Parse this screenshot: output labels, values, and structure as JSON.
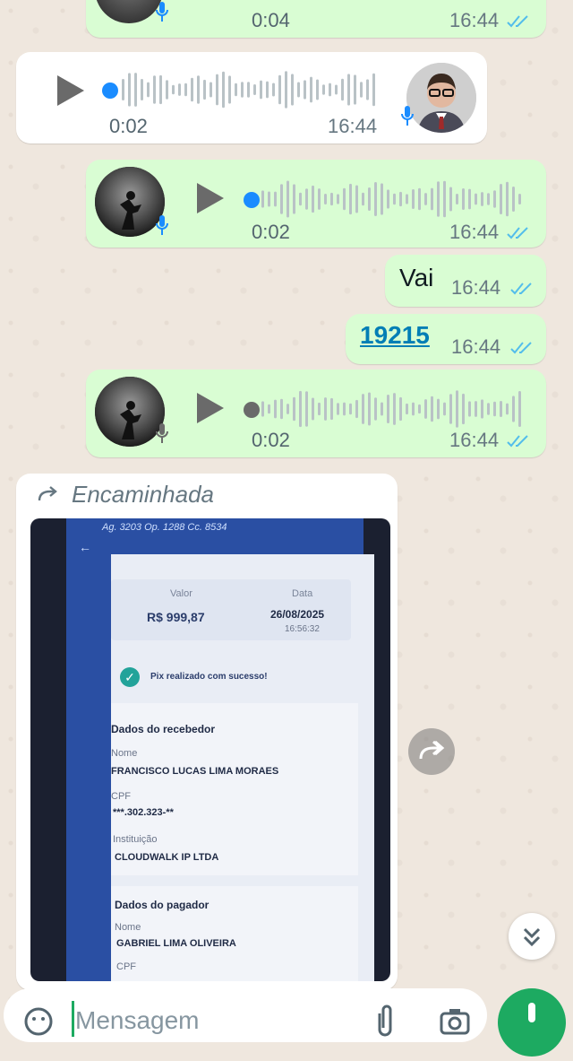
{
  "colors": {
    "outgoing_bubble": "#d9fdd3",
    "incoming_bubble": "#ffffff",
    "read_ticks": "#53bdeb",
    "unplayed_knob": "#1a8cff",
    "played_knob": "#6a6a6a",
    "link": "#027eb5",
    "send_button": "#1daa61"
  },
  "messages": [
    {
      "type": "voice",
      "direction": "outgoing",
      "duration": "0:04",
      "time": "16:44",
      "status": "read"
    },
    {
      "type": "voice",
      "direction": "incoming",
      "duration": "0:02",
      "time": "16:44",
      "unplayed": true
    },
    {
      "type": "voice",
      "direction": "outgoing",
      "duration": "0:02",
      "time": "16:44",
      "status": "read",
      "unplayed": true
    },
    {
      "type": "text",
      "direction": "outgoing",
      "text": "Vai",
      "time": "16:44",
      "status": "read"
    },
    {
      "type": "link",
      "direction": "outgoing",
      "text": "19215",
      "time": "16:44",
      "status": "read"
    },
    {
      "type": "voice",
      "direction": "outgoing",
      "duration": "0:02",
      "time": "16:44",
      "status": "read"
    },
    {
      "type": "image",
      "direction": "incoming",
      "forwarded_label": "Encaminhada"
    }
  ],
  "receipt": {
    "account_line": "Ag. 3203 Op. 1288 Cc. 8534",
    "value_label": "Valor",
    "value": "R$ 999,87",
    "date_label": "Data",
    "date": "26/08/2025",
    "time": "16:56:32",
    "success": "Pix realizado com sucesso!",
    "receiver_header": "Dados do recebedor",
    "name_label": "Nome",
    "receiver_name": "FRANCISCO LUCAS LIMA MORAES",
    "cpf_label": "CPF",
    "receiver_cpf": "***.302.323-**",
    "institution_label": "Instituição",
    "institution": "CLOUDWALK IP LTDA",
    "payer_header": "Dados do pagador",
    "payer_name_label": "Nome",
    "payer_name": "GABRIEL LIMA OLIVEIRA",
    "payer_cpf_label": "CPF"
  },
  "input": {
    "placeholder": "Mensagem"
  },
  "icons": {
    "forward": "forward-icon",
    "scroll_down": "double-chevron-down-icon",
    "emoji": "emoji-icon",
    "attach": "paperclip-icon",
    "camera": "camera-icon",
    "mic": "mic-icon"
  }
}
